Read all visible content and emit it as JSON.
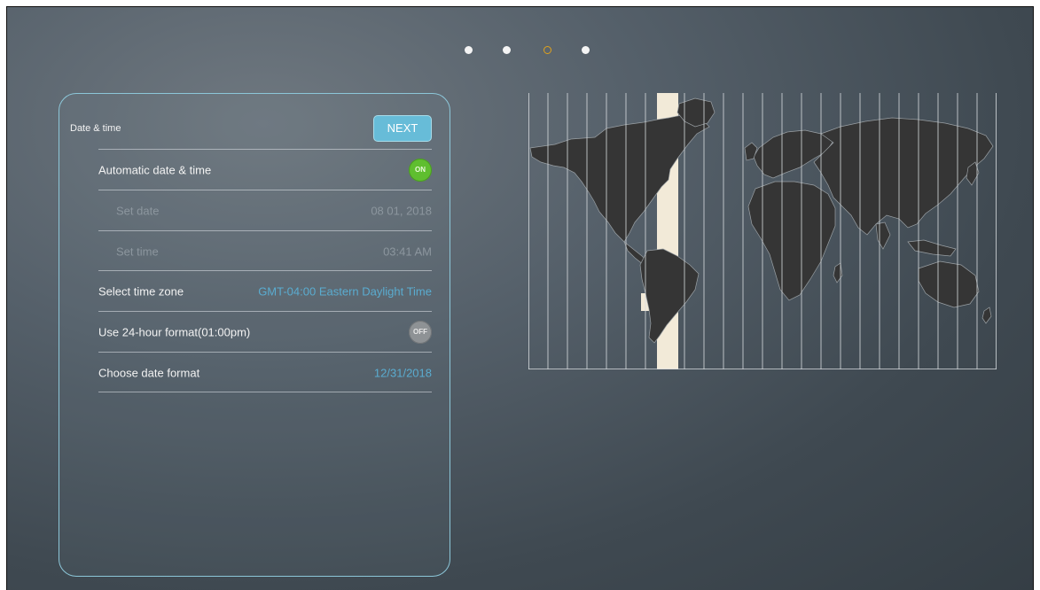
{
  "pager": {
    "count": 4,
    "active_index": 2,
    "active_color": "#e0a21c"
  },
  "panel": {
    "title": "Date & time",
    "next_label": "NEXT",
    "rows": {
      "automatic": {
        "label": "Automatic date & time",
        "toggle": "ON"
      },
      "set_date": {
        "label": "Set date",
        "value": "08 01, 2018"
      },
      "set_time": {
        "label": "Set time",
        "value": "03:41 AM"
      },
      "time_zone": {
        "label": "Select time zone",
        "value": "GMT-04:00 Eastern Daylight Time"
      },
      "hour24": {
        "label": "Use 24-hour format(01:00pm)",
        "toggle": "OFF"
      },
      "date_format": {
        "label": "Choose date format",
        "value": "12/31/2018"
      }
    }
  },
  "map": {
    "icon": "world-timezone-map",
    "highlight_color": "#f2ead8"
  },
  "colors": {
    "accent": "#67bcd8",
    "toggle_on": "#5fbe2f",
    "toggle_off": "#8e9295",
    "link": "#5aacd0"
  }
}
